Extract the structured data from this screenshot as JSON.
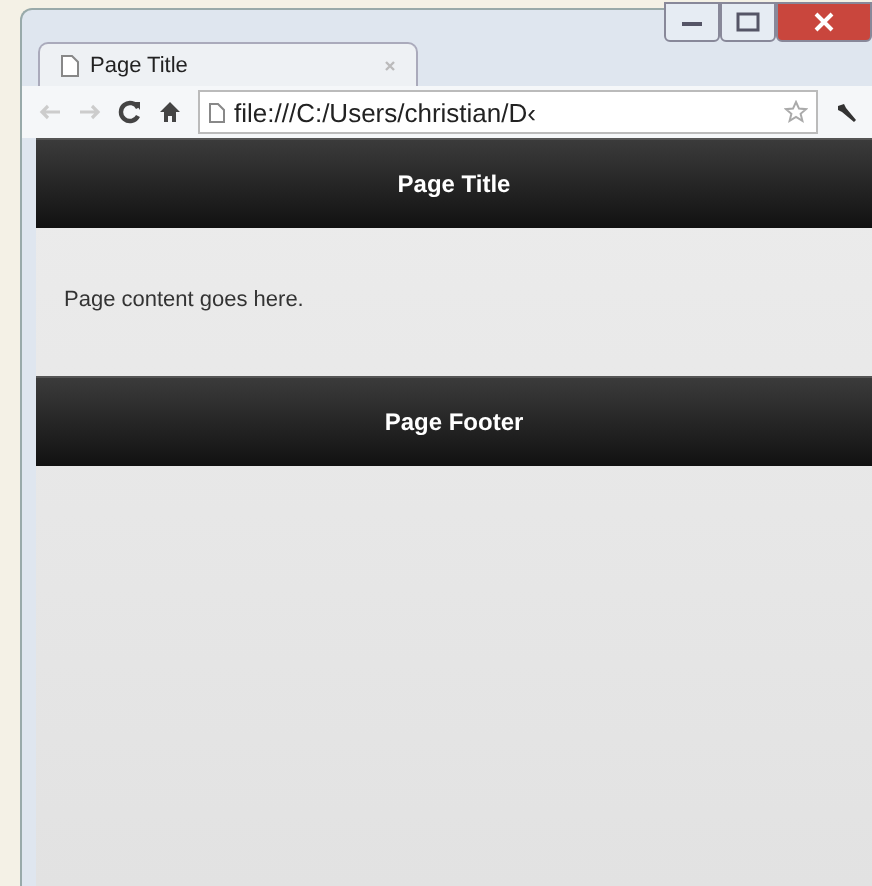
{
  "tab": {
    "title": "Page Title"
  },
  "toolbar": {
    "url": "file:///C:/Users/christian/D‹"
  },
  "page": {
    "header": "Page Title",
    "content": "Page content goes here.",
    "footer": "Page Footer"
  }
}
